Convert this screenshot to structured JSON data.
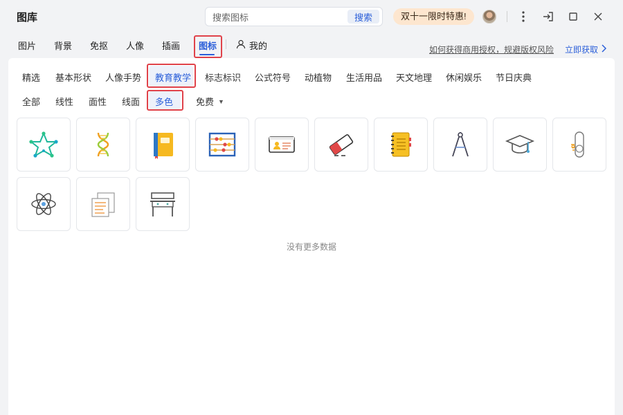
{
  "app": {
    "title": "图库"
  },
  "search": {
    "placeholder": "搜索图标",
    "button": "搜索"
  },
  "promo": {
    "text": "双十一限时特惠!"
  },
  "main_tabs": [
    {
      "label": "图片"
    },
    {
      "label": "背景"
    },
    {
      "label": "免抠"
    },
    {
      "label": "人像"
    },
    {
      "label": "插画"
    },
    {
      "label": "图标",
      "active": true
    }
  ],
  "mine_tab": {
    "label": "我的"
  },
  "license_link": "如何获得商用授权，规避版权风险",
  "get_link": "立即获取",
  "categories": [
    {
      "label": "精选"
    },
    {
      "label": "基本形状"
    },
    {
      "label": "人像手势"
    },
    {
      "label": "教育教学",
      "active": true
    },
    {
      "label": "标志标识"
    },
    {
      "label": "公式符号"
    },
    {
      "label": "动植物"
    },
    {
      "label": "生活用品"
    },
    {
      "label": "天文地理"
    },
    {
      "label": "休闲娱乐"
    },
    {
      "label": "节日庆典"
    }
  ],
  "styles": [
    {
      "label": "全部"
    },
    {
      "label": "线性"
    },
    {
      "label": "面性"
    },
    {
      "label": "线面"
    },
    {
      "label": "多色",
      "active": true
    }
  ],
  "price_filter": {
    "selected": "免费"
  },
  "icons": [
    {
      "name": "star-network-icon"
    },
    {
      "name": "dna-icon"
    },
    {
      "name": "book-icon"
    },
    {
      "name": "abacus-icon"
    },
    {
      "name": "id-card-icon"
    },
    {
      "name": "eraser-icon"
    },
    {
      "name": "notebook-icon"
    },
    {
      "name": "compass-drawing-icon"
    },
    {
      "name": "graduation-cap-icon"
    },
    {
      "name": "diploma-scroll-icon"
    },
    {
      "name": "atom-icon"
    },
    {
      "name": "documents-icon"
    },
    {
      "name": "school-desk-icon"
    }
  ],
  "empty_state": {
    "text": "没有更多数据"
  },
  "colors": {
    "accent": "#2b5fd9",
    "highlight": "#e0424a",
    "promo_bg": "#fde6cf"
  }
}
